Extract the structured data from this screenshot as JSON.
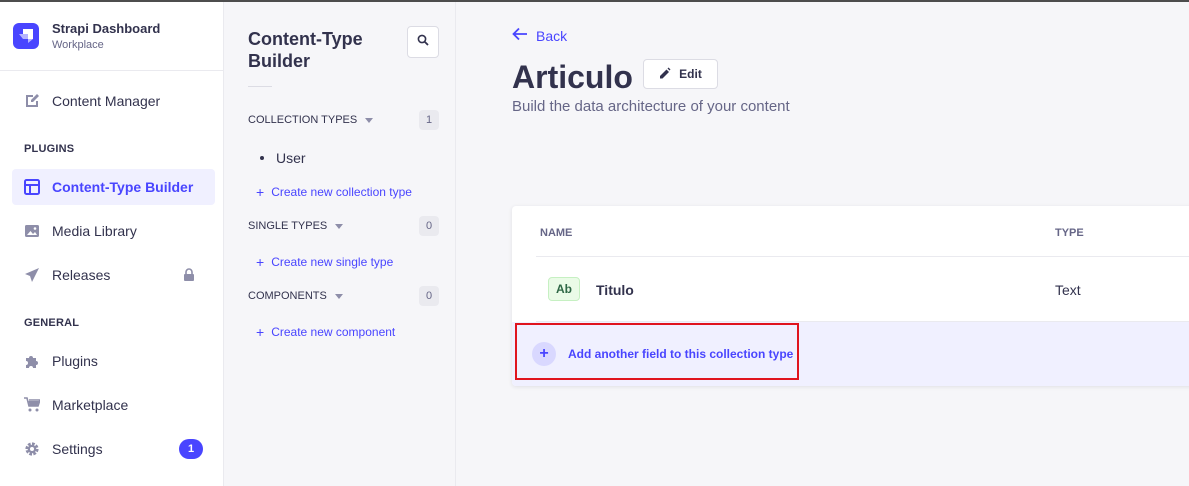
{
  "brand": {
    "title": "Strapi Dashboard",
    "subtitle": "Workplace",
    "accent": "#4945ff"
  },
  "mainnav": {
    "content_manager": "Content Manager",
    "plugins_section": "PLUGINS",
    "ctb": "Content-Type Builder",
    "media": "Media Library",
    "releases": "Releases",
    "general_section": "GENERAL",
    "plugins": "Plugins",
    "marketplace": "Marketplace",
    "settings": "Settings",
    "settings_badge": "1"
  },
  "subnav": {
    "title": "Content-Type Builder",
    "collection_types": {
      "label": "COLLECTION TYPES",
      "count": "1",
      "items": [
        "User"
      ],
      "create": "Create new collection type"
    },
    "single_types": {
      "label": "SINGLE TYPES",
      "count": "0",
      "create": "Create new single type"
    },
    "components": {
      "label": "COMPONENTS",
      "count": "0",
      "create": "Create new component"
    }
  },
  "header": {
    "back": "Back",
    "title": "Articulo",
    "edit": "Edit",
    "subtitle": "Build the data architecture of your content"
  },
  "table": {
    "col_name": "NAME",
    "col_type": "TYPE",
    "rows": [
      {
        "icon": "Ab",
        "name": "Titulo",
        "type": "Text"
      }
    ],
    "add_field": "Add another field to this collection type"
  }
}
